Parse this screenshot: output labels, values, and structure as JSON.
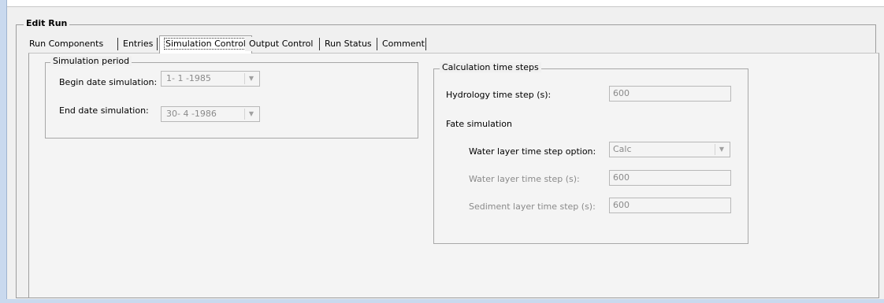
{
  "section": {
    "title": "Edit Run"
  },
  "tabs": [
    {
      "label": "Run Components"
    },
    {
      "label": "Entries"
    },
    {
      "label": "Simulation Control"
    },
    {
      "label": "Output Control"
    },
    {
      "label": "Run Status"
    },
    {
      "label": "Comment"
    }
  ],
  "active_tab": "Simulation Control",
  "simulation_period": {
    "legend": "Simulation period",
    "begin_label": "Begin date simulation:",
    "begin_value": "1- 1 -1985",
    "end_label": "End date simulation:",
    "end_value": "30- 4 -1986"
  },
  "calc_steps": {
    "legend": "Calculation time steps",
    "hydro_label": "Hydrology time step (s):",
    "hydro_value": "600",
    "fate_label": "Fate simulation",
    "water_option_label": "Water layer time step option:",
    "water_option_value": "Calc",
    "water_step_label": "Water layer time step (s):",
    "water_step_value": "600",
    "sediment_step_label": "Sediment layer time step (s):",
    "sediment_step_value": "600"
  },
  "icons": {
    "dropdown": "chevron-down-icon"
  }
}
